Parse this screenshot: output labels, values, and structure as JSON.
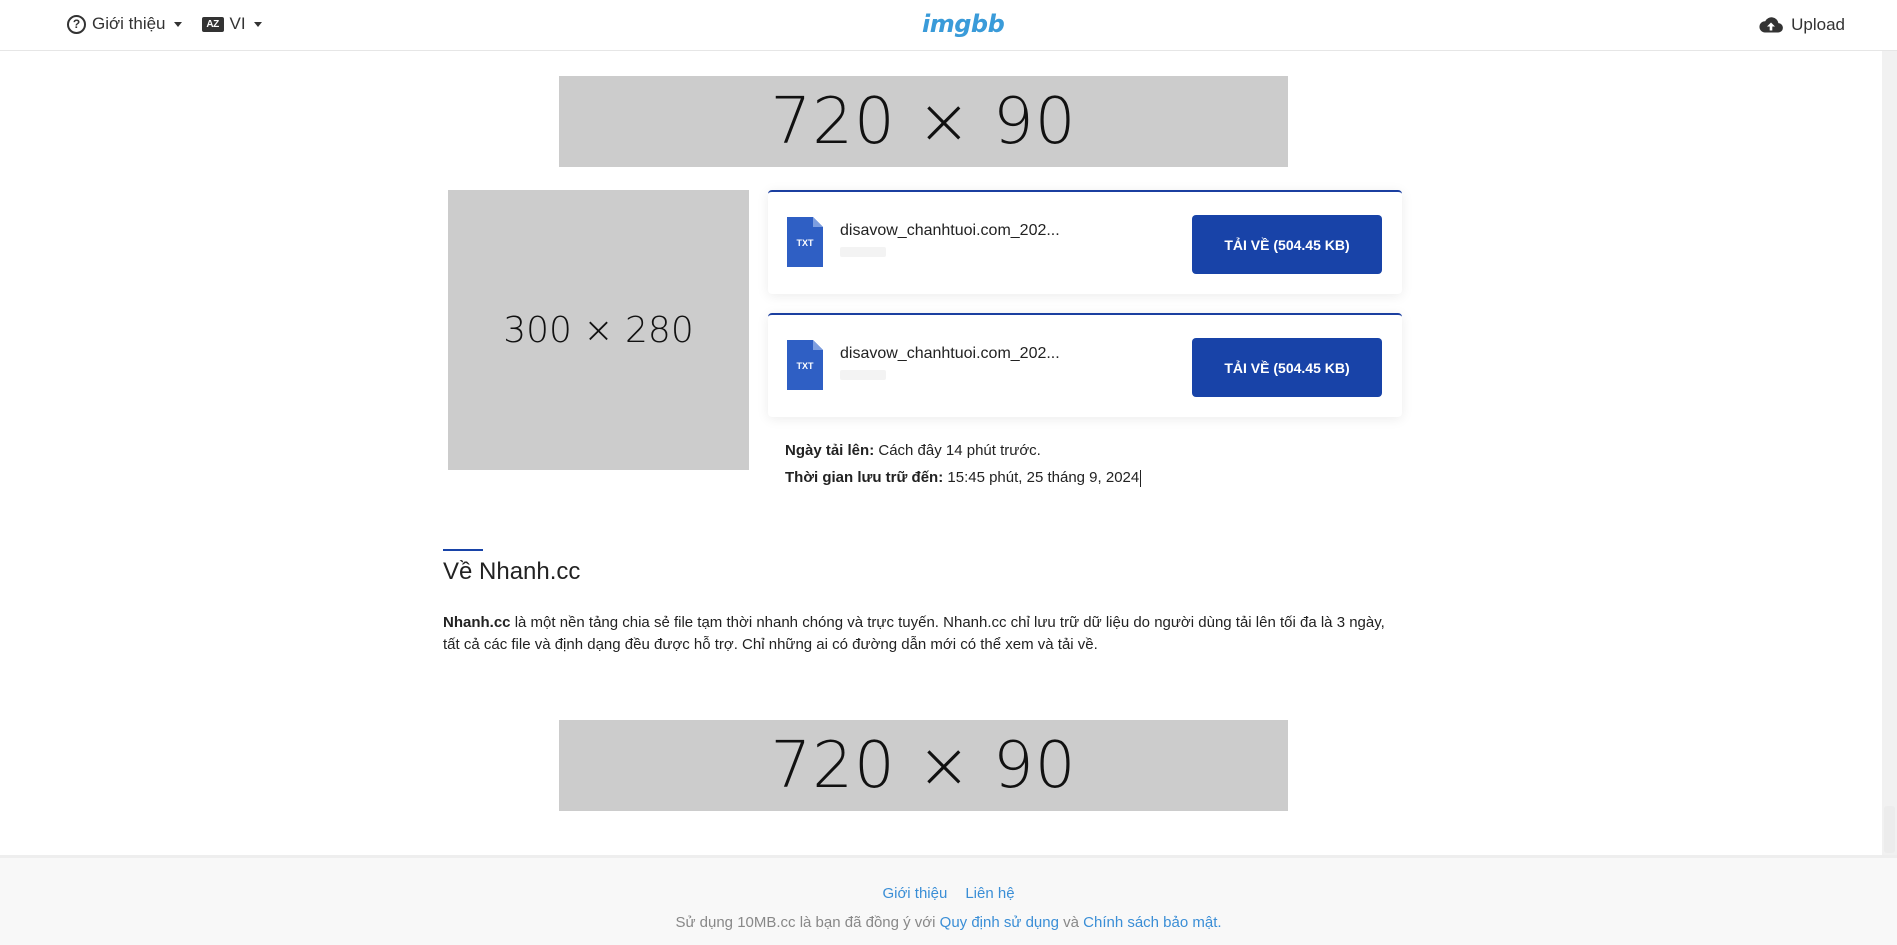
{
  "header": {
    "about_label": "Giới thiệu",
    "lang_label": "VI",
    "lang_icon_text": "AZ",
    "logo": "imgbb",
    "upload_label": "Upload"
  },
  "ads": {
    "top": "720 × 90",
    "square": "300 × 280",
    "bottom": "720 × 90"
  },
  "files": [
    {
      "name": "disavow_chanhtuoi.com_202...",
      "icon_text": "TXT",
      "button_label": "TẢI VỀ (504.45 KB)"
    },
    {
      "name": "disavow_chanhtuoi.com_202...",
      "icon_text": "TXT",
      "button_label": "TẢI VỀ (504.45 KB)"
    }
  ],
  "meta": {
    "upload_date_label": "Ngày tải lên:",
    "upload_date_value": "Cách đây 14 phút trước.",
    "expire_label": "Thời gian lưu trữ đến:",
    "expire_value": "15:45 phút, 25 tháng 9, 2024"
  },
  "about": {
    "title": "Về Nhanh.cc",
    "brand": "Nhanh.cc",
    "text": "là một nền tảng chia sẻ file tạm thời nhanh chóng và trực tuyến. Nhanh.cc chỉ lưu trữ dữ liệu do người dùng tải lên tối đa là 3 ngày, tất cả các file và định dạng đều được hỗ trợ. Chỉ những ai có đường dẫn mới có thể xem và tải về."
  },
  "footer": {
    "link_about": "Giới thiệu",
    "link_contact": "Liên hệ",
    "note_prefix": "Sử dụng 10MB.cc là bạn đã đồng ý với",
    "terms": "Quy định sử dụng",
    "and": "và",
    "privacy": "Chính sách bảo mật."
  },
  "colors": {
    "accent": "#1843a8",
    "link": "#3a8ed6",
    "logo": "#3a9bd9",
    "ad_placeholder": "#cccccc"
  },
  "icons": {
    "help": "question-circle-icon",
    "language": "language-icon",
    "upload": "cloud-upload-icon",
    "file": "txt-file-icon"
  }
}
